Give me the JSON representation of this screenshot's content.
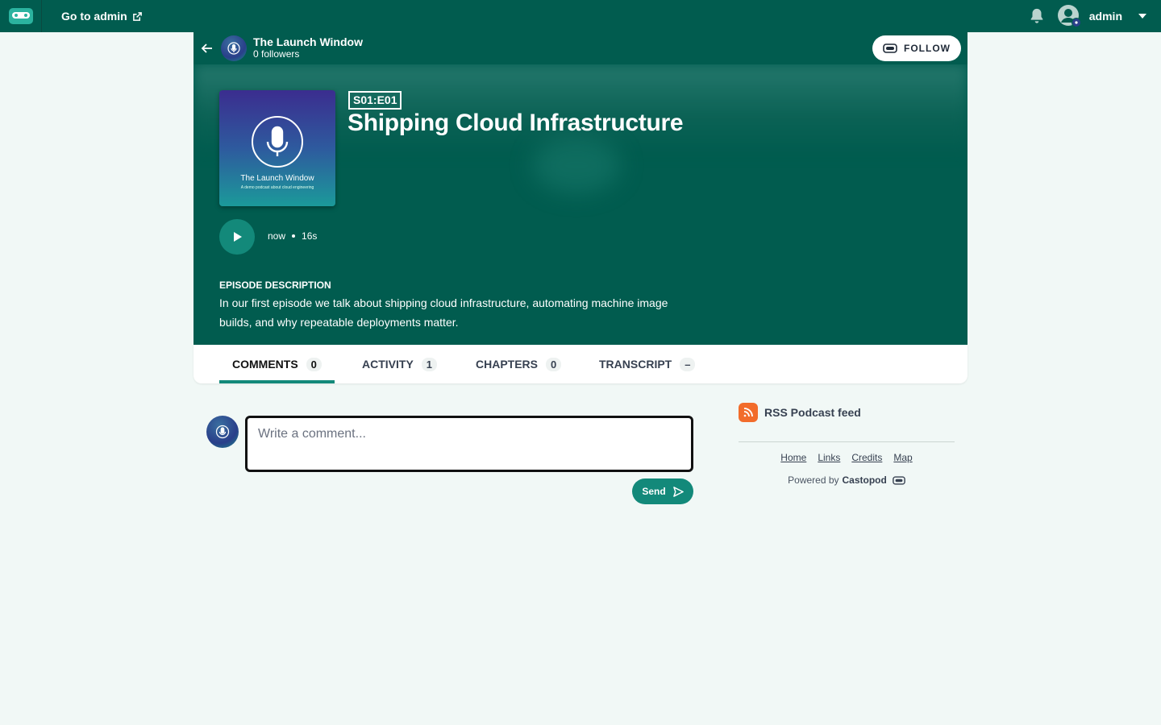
{
  "topbar": {
    "go_to_admin": "Go to admin",
    "username": "admin"
  },
  "podcast": {
    "title": "The Launch Window",
    "followers": "0 followers",
    "follow_label": "FOLLOW"
  },
  "episode": {
    "cover_title": "The Launch Window",
    "cover_subtitle": "A demo podcast about cloud engineering",
    "badge": "S01:E01",
    "title": "Shipping Cloud Infrastructure",
    "published": "now",
    "duration": "16s",
    "description_label": "EPISODE DESCRIPTION",
    "description": "In our first episode we talk about shipping cloud infrastructure, automating machine image builds, and why repeatable deployments matter."
  },
  "tabs": [
    {
      "label": "COMMENTS",
      "count": "0",
      "active": true
    },
    {
      "label": "ACTIVITY",
      "count": "1",
      "active": false
    },
    {
      "label": "CHAPTERS",
      "count": "0",
      "active": false
    },
    {
      "label": "TRANSCRIPT",
      "count": "–",
      "active": false
    }
  ],
  "comment_form": {
    "placeholder": "Write a comment...",
    "send_label": "Send"
  },
  "sidebar": {
    "rss_label": "RSS Podcast feed",
    "footer_links": [
      "Home",
      "Links",
      "Credits",
      "Map"
    ],
    "powered_by": "Powered by",
    "powered_brand": "Castopod"
  },
  "colors": {
    "brand_dark": "#015c4f",
    "accent": "#13897a",
    "rss": "#f26c2b",
    "background": "#f1f8f6"
  },
  "icons": {
    "logo": "castopod-logo-icon",
    "external": "external-link-icon",
    "bell": "bell-icon",
    "user": "user-circle-icon",
    "caret": "caret-down-icon",
    "back": "arrow-left-icon",
    "play": "play-icon",
    "send": "send-icon",
    "rss": "rss-icon"
  }
}
